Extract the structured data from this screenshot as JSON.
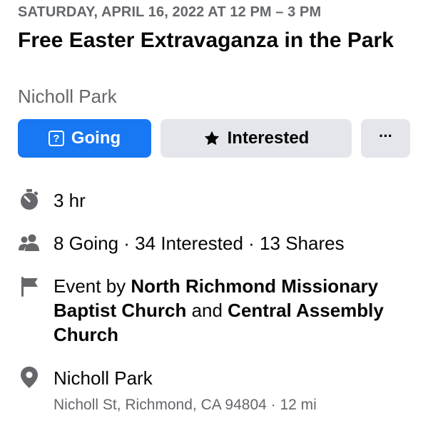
{
  "event": {
    "date": "SATURDAY, APRIL 16, 2022 AT 12 PM – 3 PM",
    "title": "Free Easter Extravaganza in the Park",
    "location_header": "Nicholl Park"
  },
  "actions": {
    "going_label": "Going",
    "going_icon_glyph": "?",
    "interested_label": "Interested",
    "more_label": "···"
  },
  "details": {
    "duration": "3 hr",
    "stats": "8 Going · 34 Interested · 13 Shares",
    "host_prefix": "Event by ",
    "host_1": "North Richmond Missionary Baptist Church",
    "host_joiner": " and ",
    "host_2": "Central Assembly Church",
    "location_name": "Nicholl Park",
    "location_address": "Nicholl St, Richmond, CA 94804 · 12 mi"
  },
  "colors": {
    "primary": "#1877f2",
    "secondary_button": "#e4e6eb",
    "secondary_text": "#65676b",
    "icon_gray": "#65676b"
  },
  "icons": {
    "going": "question-box-icon",
    "interested": "star-icon",
    "duration": "stopwatch-icon",
    "stats": "people-icon",
    "host": "flag-icon",
    "location": "map-pin-icon"
  }
}
